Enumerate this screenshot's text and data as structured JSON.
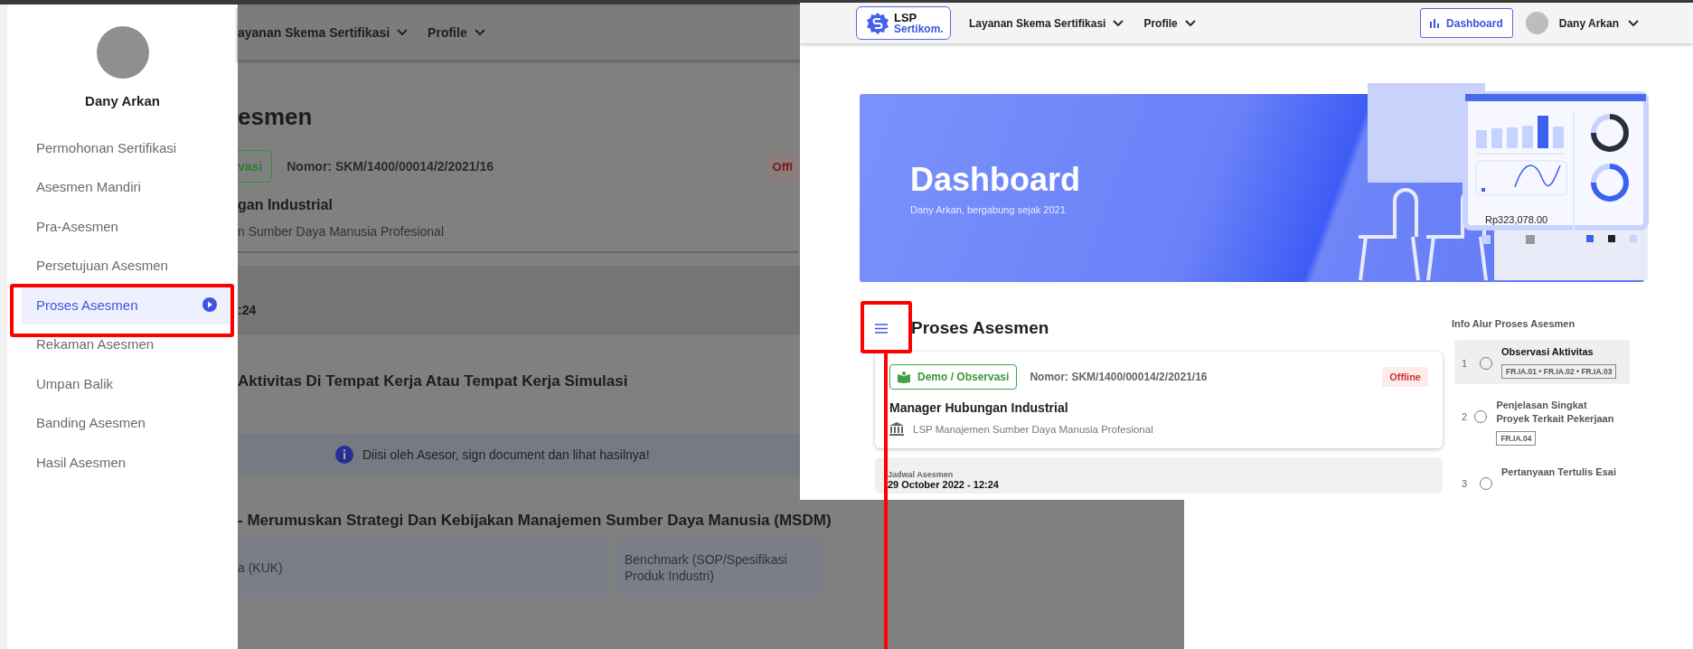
{
  "background_page": {
    "nav": [
      {
        "label": "ayanan Skema Sertifikasi"
      },
      {
        "label": "Profile"
      }
    ],
    "heading": "esmen",
    "card": {
      "badge": "vasi",
      "number": "Nomor: SKM/1400/00014/2/2021/16",
      "status": "Offl",
      "title": "gan Industrial",
      "institution": "n Sumber Daya Manusia Profesional"
    },
    "schedule_time": ":24",
    "activity_title": "Aktivitas Di Tempat Kerja Atau Tempat Kerja Simulasi",
    "info_banner": "Diisi oleh Asesor, sign document dan lihat hasilnya!",
    "unit_title": "- Merumuskan Strategi Dan Kebijakan Manajemen Sumber Daya Manusia (MSDM)",
    "table": {
      "columns": [
        "a (KUK)",
        "Benchmark (SOP/Spesifikasi Produk Industri)"
      ]
    }
  },
  "sidebar": {
    "user_name": "Dany Arkan",
    "items": [
      {
        "label": "Permohonan Sertifikasi",
        "selected": false
      },
      {
        "label": "Asesmen Mandiri",
        "selected": false
      },
      {
        "label": "Pra-Asesmen",
        "selected": false
      },
      {
        "label": "Persetujuan Asesmen",
        "selected": false
      },
      {
        "label": "Proses Asesmen",
        "selected": true
      },
      {
        "label": "Rekaman Asesmen",
        "selected": false
      },
      {
        "label": "Umpan Balik",
        "selected": false
      },
      {
        "label": "Banding Asesmen",
        "selected": false
      },
      {
        "label": "Hasil Asesmen",
        "selected": false
      }
    ]
  },
  "dashboard_page": {
    "logo": {
      "line1": "LSP",
      "line2": "Sertikom."
    },
    "nav": [
      {
        "label": "Layanan Skema Sertifikasi"
      },
      {
        "label": "Profile"
      }
    ],
    "dashboard_button": "Dashboard",
    "user_name": "Dany Arkan",
    "banner": {
      "title": "Dashboard",
      "subtitle": "Dany Arkan, bergabung sejak 2021",
      "amount": "Rp323,078.00"
    },
    "section_title": "Proses Asesmen",
    "card": {
      "badge": "Demo / Observasi",
      "number": "Nomor: SKM/1400/00014/2/2021/16",
      "status": "Offline",
      "title": "Manager Hubungan Industrial",
      "institution": "LSP Manajemen Sumber Daya Manusia Profesional"
    },
    "schedule": {
      "label": "Jadwal Asesmen",
      "value": "29 October 2022 - 12:24"
    },
    "info_title": "Info Alur Proses Asesmen",
    "steps": [
      {
        "number": "1",
        "title": "Observasi Aktivitas",
        "tags": "FR.IA.01 • FR.IA.02 • FR.IA.03",
        "selected": true
      },
      {
        "number": "2",
        "title": "Penjelasan Singkat Proyek Terkait Pekerjaan",
        "tags": "FR.IA.04",
        "selected": false
      },
      {
        "number": "3",
        "title": "Pertanyaan Tertulis Esai",
        "selected": false
      }
    ]
  }
}
